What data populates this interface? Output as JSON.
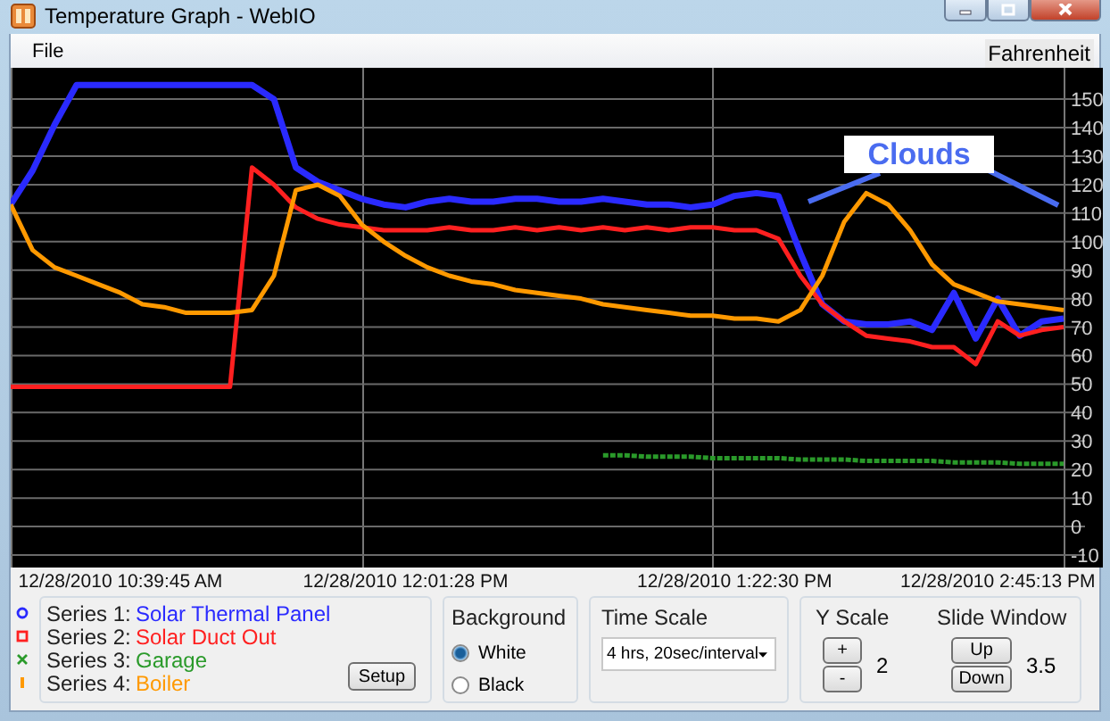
{
  "window": {
    "title": "Temperature Graph - WebIO"
  },
  "menu": {
    "items": [
      "File"
    ],
    "unit": "Fahrenheit"
  },
  "chart": {
    "chart_data": {
      "type": "line",
      "ylim": [
        -10,
        161
      ],
      "yticks": [
        -10,
        0,
        10,
        20,
        30,
        40,
        50,
        60,
        70,
        80,
        90,
        100,
        110,
        120,
        130,
        140,
        150
      ],
      "grid": true,
      "categories": [
        null,
        null,
        null,
        null,
        null,
        "12/28/2010 10:39:45 AM",
        null,
        null,
        null,
        null,
        null,
        null,
        null,
        null,
        null,
        null,
        null,
        null,
        "12/28/2010 12:01:28 PM",
        null,
        null,
        null,
        null,
        null,
        null,
        null,
        null,
        null,
        null,
        null,
        null,
        null,
        null,
        "12/28/2010 1:22:30 PM",
        null,
        null,
        null,
        null,
        null,
        null,
        null,
        null,
        null,
        null,
        null,
        "12/28/2010 2:45:13 PM",
        null,
        null,
        null
      ],
      "series": [
        {
          "name": "Solar Thermal Panel",
          "color": "#2a2aff",
          "values": [
            113,
            125,
            141,
            155,
            155,
            155,
            155,
            155,
            155,
            155,
            155,
            155,
            150,
            126,
            121,
            118,
            115,
            113,
            112,
            114,
            115,
            114,
            114,
            115,
            115,
            114,
            114,
            115,
            114,
            113,
            113,
            112,
            113,
            116,
            117,
            116,
            96,
            78,
            72,
            71,
            71,
            72,
            69,
            82,
            66,
            80,
            67,
            72,
            73
          ]
        },
        {
          "name": "Solar Duct Out",
          "color": "#ff2020",
          "values": [
            49,
            49,
            49,
            49,
            49,
            49,
            49,
            49,
            49,
            49,
            49,
            126,
            120,
            112,
            108,
            106,
            105,
            104,
            104,
            104,
            105,
            104,
            104,
            105,
            104,
            105,
            104,
            105,
            104,
            105,
            104,
            105,
            105,
            104,
            104,
            101,
            88,
            78,
            72,
            67,
            66,
            65,
            63,
            63,
            57,
            72,
            67,
            69,
            70
          ]
        },
        {
          "name": "Garage",
          "color": "#2a9a2a",
          "line_style": "dashed",
          "values": [
            null,
            null,
            null,
            null,
            null,
            null,
            null,
            null,
            null,
            null,
            null,
            null,
            null,
            null,
            null,
            null,
            null,
            null,
            null,
            null,
            null,
            null,
            null,
            null,
            null,
            null,
            null,
            25,
            25,
            24.5,
            24.5,
            24.5,
            24,
            24,
            24,
            24,
            23.5,
            23.5,
            23.5,
            23,
            23,
            23,
            23,
            22.5,
            22.5,
            22.5,
            22,
            22,
            22
          ]
        },
        {
          "name": "Boiler",
          "color": "#ff9900",
          "values": [
            113,
            97,
            91,
            88,
            85,
            82,
            78,
            77,
            75,
            75,
            75,
            76,
            88,
            118,
            120,
            116,
            106,
            100,
            95,
            91,
            88,
            86,
            85,
            83,
            82,
            81,
            80,
            78,
            77,
            76,
            75,
            74,
            74,
            73,
            73,
            72,
            76,
            88,
            107,
            117,
            113,
            104,
            92,
            85,
            82,
            79,
            78,
            77,
            76
          ]
        }
      ],
      "annotations": [
        "Clouds"
      ]
    }
  },
  "legend": {
    "items": [
      {
        "kind": "circle",
        "label": "Series 1:"
      },
      {
        "kind": "square",
        "label": "Series 2:"
      },
      {
        "kind": "cross",
        "label": "Series 3:"
      },
      {
        "kind": "tick",
        "label": "Series 4:"
      }
    ],
    "button": "Setup"
  },
  "background": {
    "title": "Background",
    "options": [
      {
        "label": "White",
        "selected": true
      },
      {
        "label": "Black",
        "selected": false
      }
    ]
  },
  "time_scale": {
    "title": "Time Scale",
    "value": "4 hrs, 20sec/interval"
  },
  "y_scale": {
    "title": "Y Scale",
    "buttons": [
      "+",
      "-"
    ],
    "value": "2"
  },
  "slide_window": {
    "title": "Slide Window",
    "buttons": [
      "Up",
      "Down"
    ],
    "value": "3.5"
  }
}
